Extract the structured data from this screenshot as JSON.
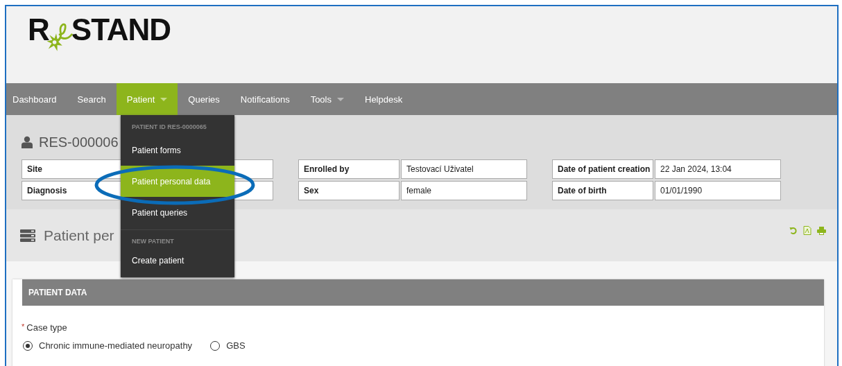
{
  "logo": {
    "before": "R",
    "after": "STAND"
  },
  "nav": [
    {
      "label": "Dashboard",
      "selected": false,
      "caret": false
    },
    {
      "label": "Search",
      "selected": false,
      "caret": false
    },
    {
      "label": "Patient",
      "selected": true,
      "caret": true
    },
    {
      "label": "Queries",
      "selected": false,
      "caret": false
    },
    {
      "label": "Notifications",
      "selected": false,
      "caret": false
    },
    {
      "label": "Tools",
      "selected": false,
      "caret": true
    },
    {
      "label": "Helpdesk",
      "selected": false,
      "caret": false
    }
  ],
  "patient_menu": [
    {
      "kind": "header",
      "label": "PATIENT ID RES-0000065"
    },
    {
      "kind": "item",
      "label": "Patient forms",
      "selected": false
    },
    {
      "kind": "item",
      "label": "Patient personal data",
      "selected": true
    },
    {
      "kind": "item",
      "label": "Patient queries",
      "selected": false
    },
    {
      "kind": "divider"
    },
    {
      "kind": "header",
      "label": "NEW PATIENT"
    },
    {
      "kind": "item",
      "label": "Create patient",
      "selected": false
    }
  ],
  "patient_title": "RES-000006",
  "info": [
    [
      {
        "label": "Site"
      },
      {
        "label": "Enrolled by",
        "value": "Testovací Uživatel"
      },
      {
        "label": "Date of patient creation",
        "value": "22 Jan 2024, 13:04"
      }
    ],
    [
      {
        "label": "Diagnosis"
      },
      {
        "label": "Sex",
        "value": "female"
      },
      {
        "label": "Date of birth",
        "value": "01/01/1990"
      }
    ]
  ],
  "section_title": "Patient per",
  "card": {
    "title": "PATIENT DATA",
    "field_label": "Case type",
    "required_mark": "*",
    "options": [
      {
        "label": "Chronic immune-mediated neuropathy",
        "selected": true
      },
      {
        "label": "GBS",
        "selected": false
      }
    ]
  }
}
